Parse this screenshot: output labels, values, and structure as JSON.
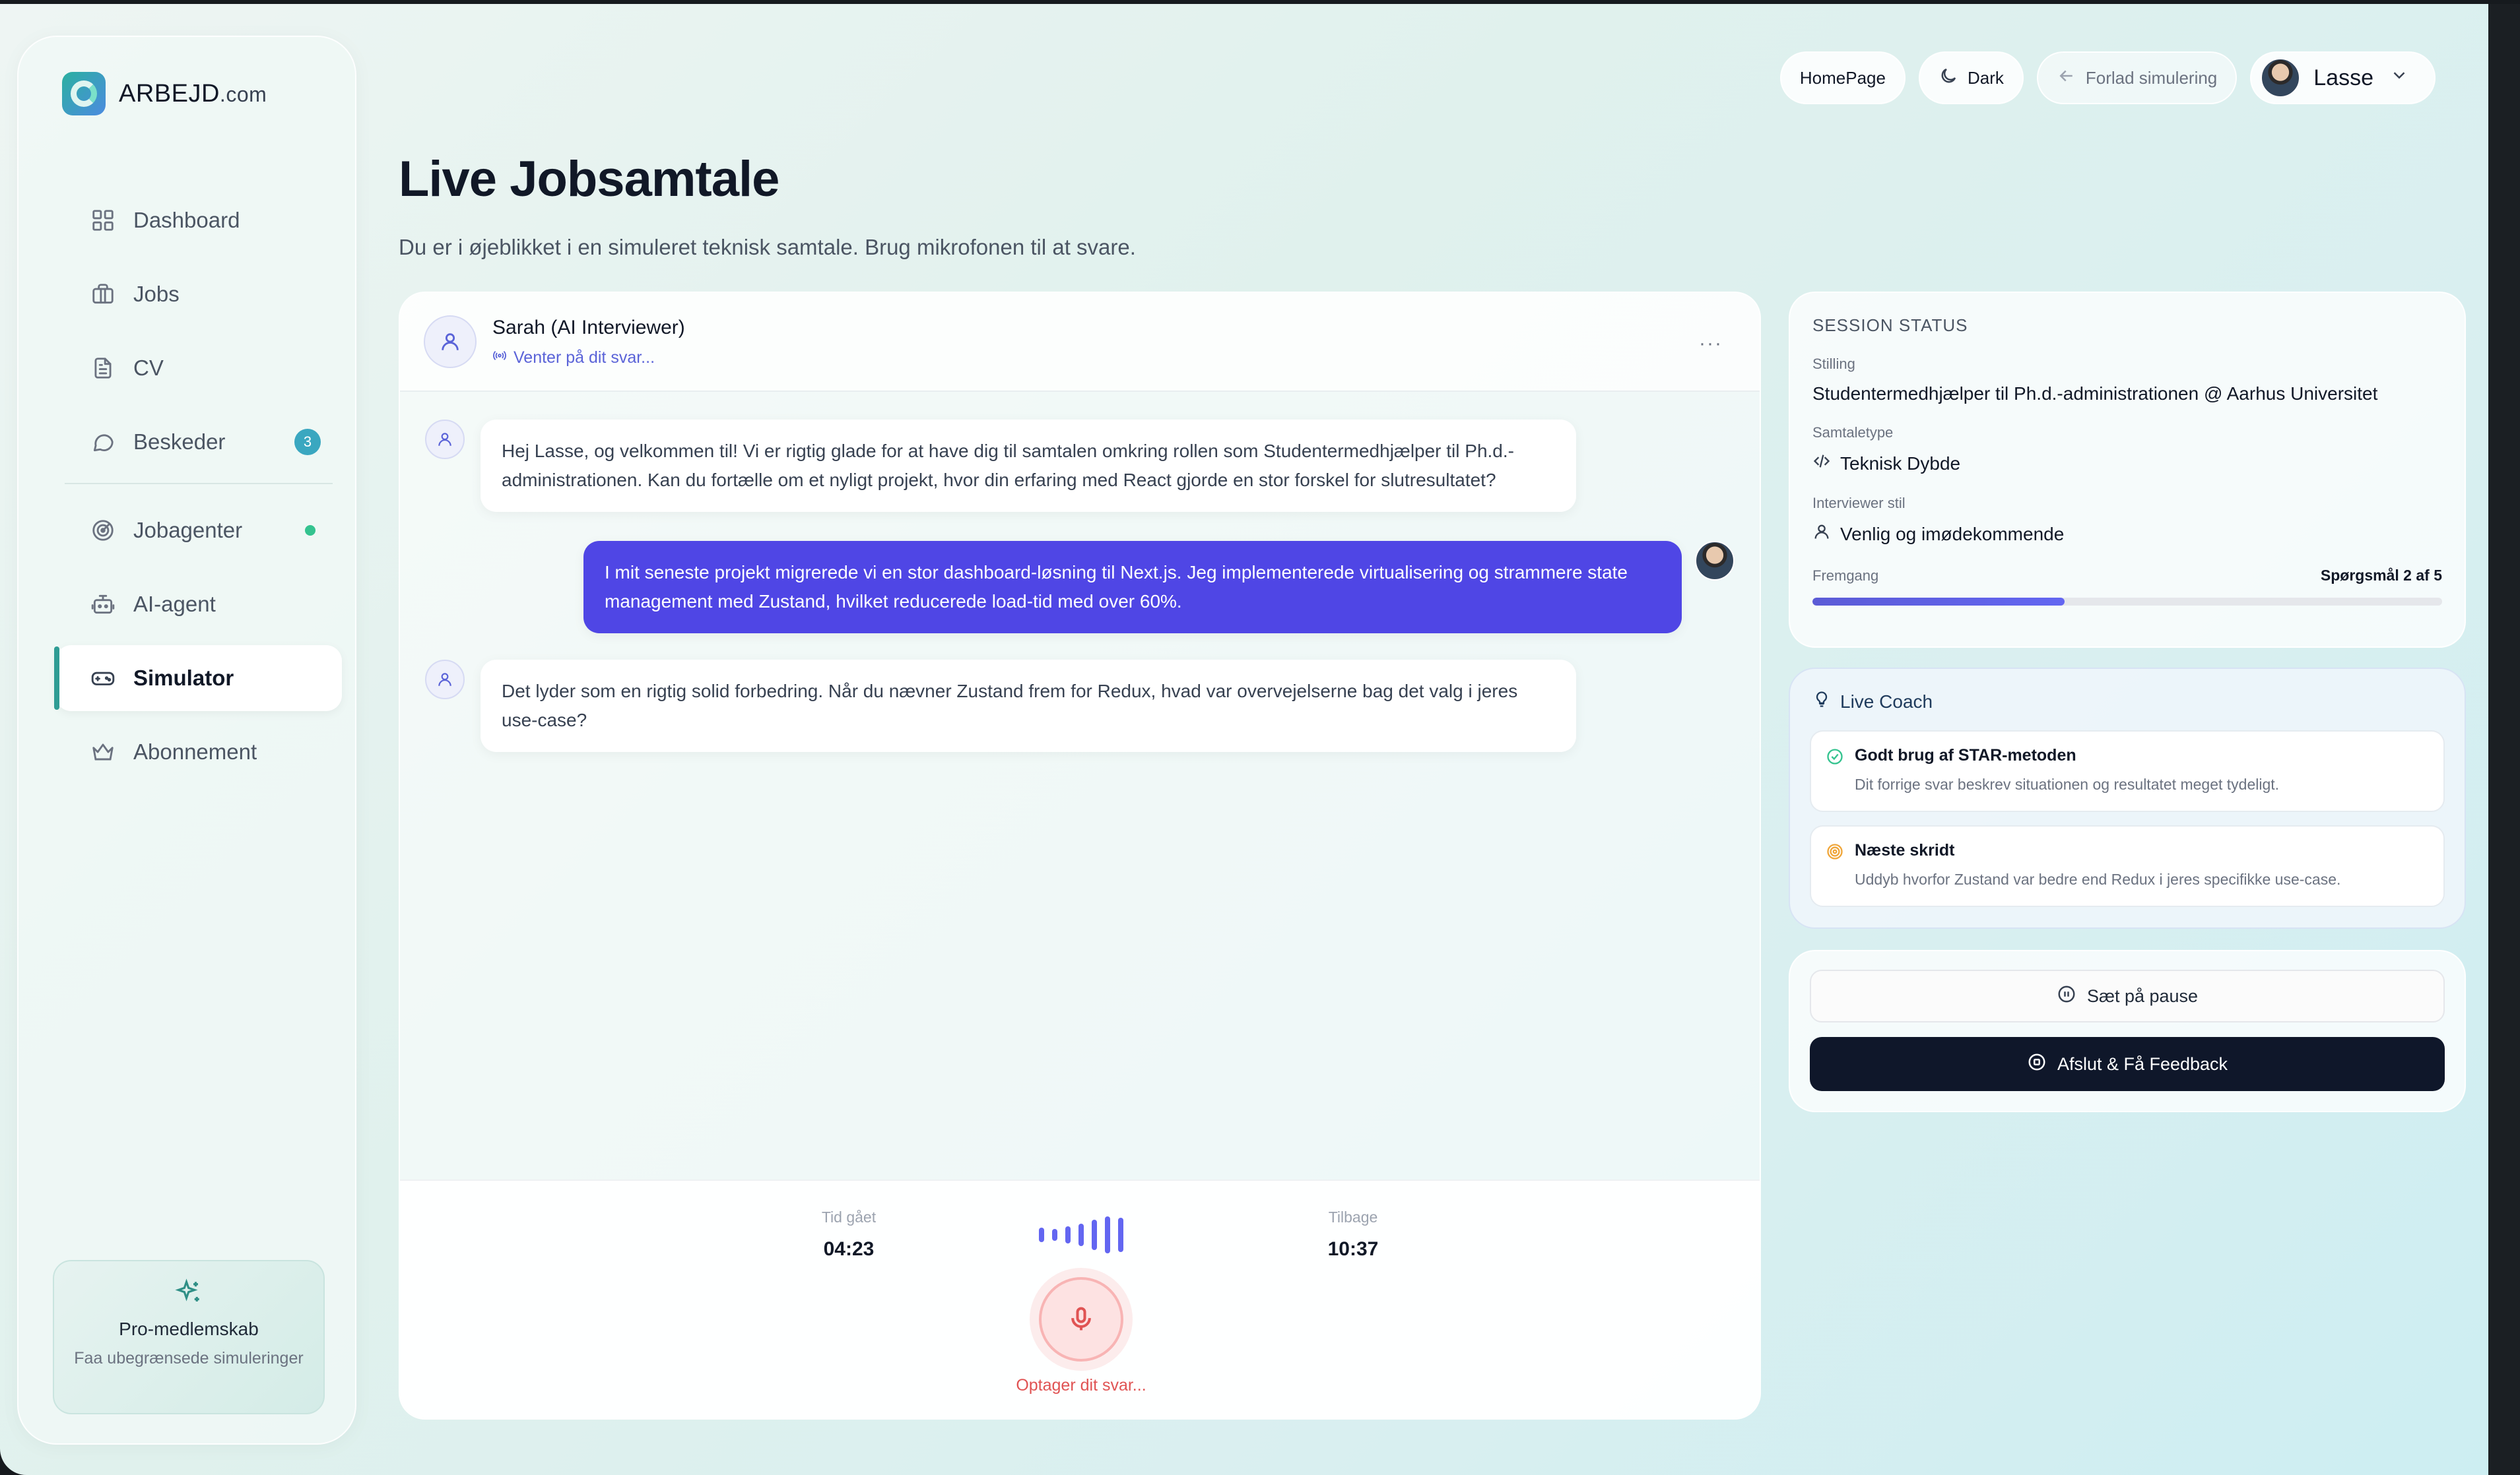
{
  "brand": {
    "name": "ARBEJD",
    "domain": ".com"
  },
  "sidebar": {
    "items": [
      {
        "label": "Dashboard",
        "icon": "grid-icon"
      },
      {
        "label": "Jobs",
        "icon": "briefcase-icon"
      },
      {
        "label": "CV",
        "icon": "document-icon"
      },
      {
        "label": "Beskeder",
        "icon": "chat-bubble-icon",
        "badge": "3"
      },
      {
        "label": "Jobagenter",
        "icon": "radar-icon"
      },
      {
        "label": "AI-agent",
        "icon": "bot-icon"
      },
      {
        "label": "Simulator",
        "icon": "gamepad-icon",
        "active": true
      },
      {
        "label": "Abonnement",
        "icon": "crown-icon"
      }
    ],
    "pro": {
      "title": "Pro-medlemskab",
      "subtitle": "Faa ubegrænsede simuleringer"
    }
  },
  "topbar": {
    "homepage": "HomePage",
    "theme": "Dark",
    "leave": "Forlad simulering",
    "user": "Lasse"
  },
  "page": {
    "title": "Live Jobsamtale",
    "subtitle": "Du er i øjeblikket i en simuleret teknisk samtale. Brug mikrofonen til at svare."
  },
  "chat": {
    "interviewer": "Sarah (AI Interviewer)",
    "status": "Venter på dit svar...",
    "more": "···",
    "messages": [
      {
        "from": "ai",
        "text": "Hej Lasse, og velkommen til! Vi er rigtig glade for at have dig til samtalen omkring rollen som Studentermedhjælper til Ph.d.-administrationen. Kan du fortælle om et nyligt projekt, hvor din erfaring med React gjorde en stor forskel for slutresultatet?"
      },
      {
        "from": "user",
        "text": "I mit seneste projekt migrerede vi en stor dashboard-løsning til Next.js. Jeg implementerede virtualisering og strammere state management med Zustand, hvilket reducerede load-tid med over 60%."
      },
      {
        "from": "ai",
        "text": "Det lyder som en rigtig solid forbedring. Når du nævner Zustand frem for Redux, hvad var overvejelserne bag det valg i jeres use-case?"
      }
    ],
    "footer": {
      "elapsed_label": "Tid gået",
      "elapsed": "04:23",
      "remaining_label": "Tilbage",
      "remaining": "10:37",
      "recording": "Optager dit svar..."
    }
  },
  "session": {
    "caption": "SESSION STATUS",
    "position_label": "Stilling",
    "position": "Studentermedhjælper til Ph.d.-administrationen @ Aarhus Universitet",
    "type_label": "Samtaletype",
    "type": "Teknisk Dybde",
    "style_label": "Interviewer stil",
    "style": "Venlig og imødekommende",
    "progress_label": "Fremgang",
    "progress_text": "Spørgsmål 2 af 5",
    "progress_current": 2,
    "progress_total": 5
  },
  "coach": {
    "title": "Live Coach",
    "tips": [
      {
        "title": "Godt brug af STAR-metoden",
        "desc": "Dit forrige svar beskrev situationen og resultatet meget tydeligt.",
        "icon": "check-circle-icon",
        "color": "#34c38f"
      },
      {
        "title": "Næste skridt",
        "desc": "Uddyb hvorfor Zustand var bedre end Redux i jeres specifikke use-case.",
        "icon": "target-icon",
        "color": "#f0a63a"
      }
    ]
  },
  "actions": {
    "pause": "Sæt på pause",
    "end": "Afslut & Få Feedback"
  },
  "colors": {
    "accent": "#4f46e5",
    "sidebar_active": "#2f9c94",
    "record": "#e05353",
    "dark_button": "#0f172a"
  }
}
